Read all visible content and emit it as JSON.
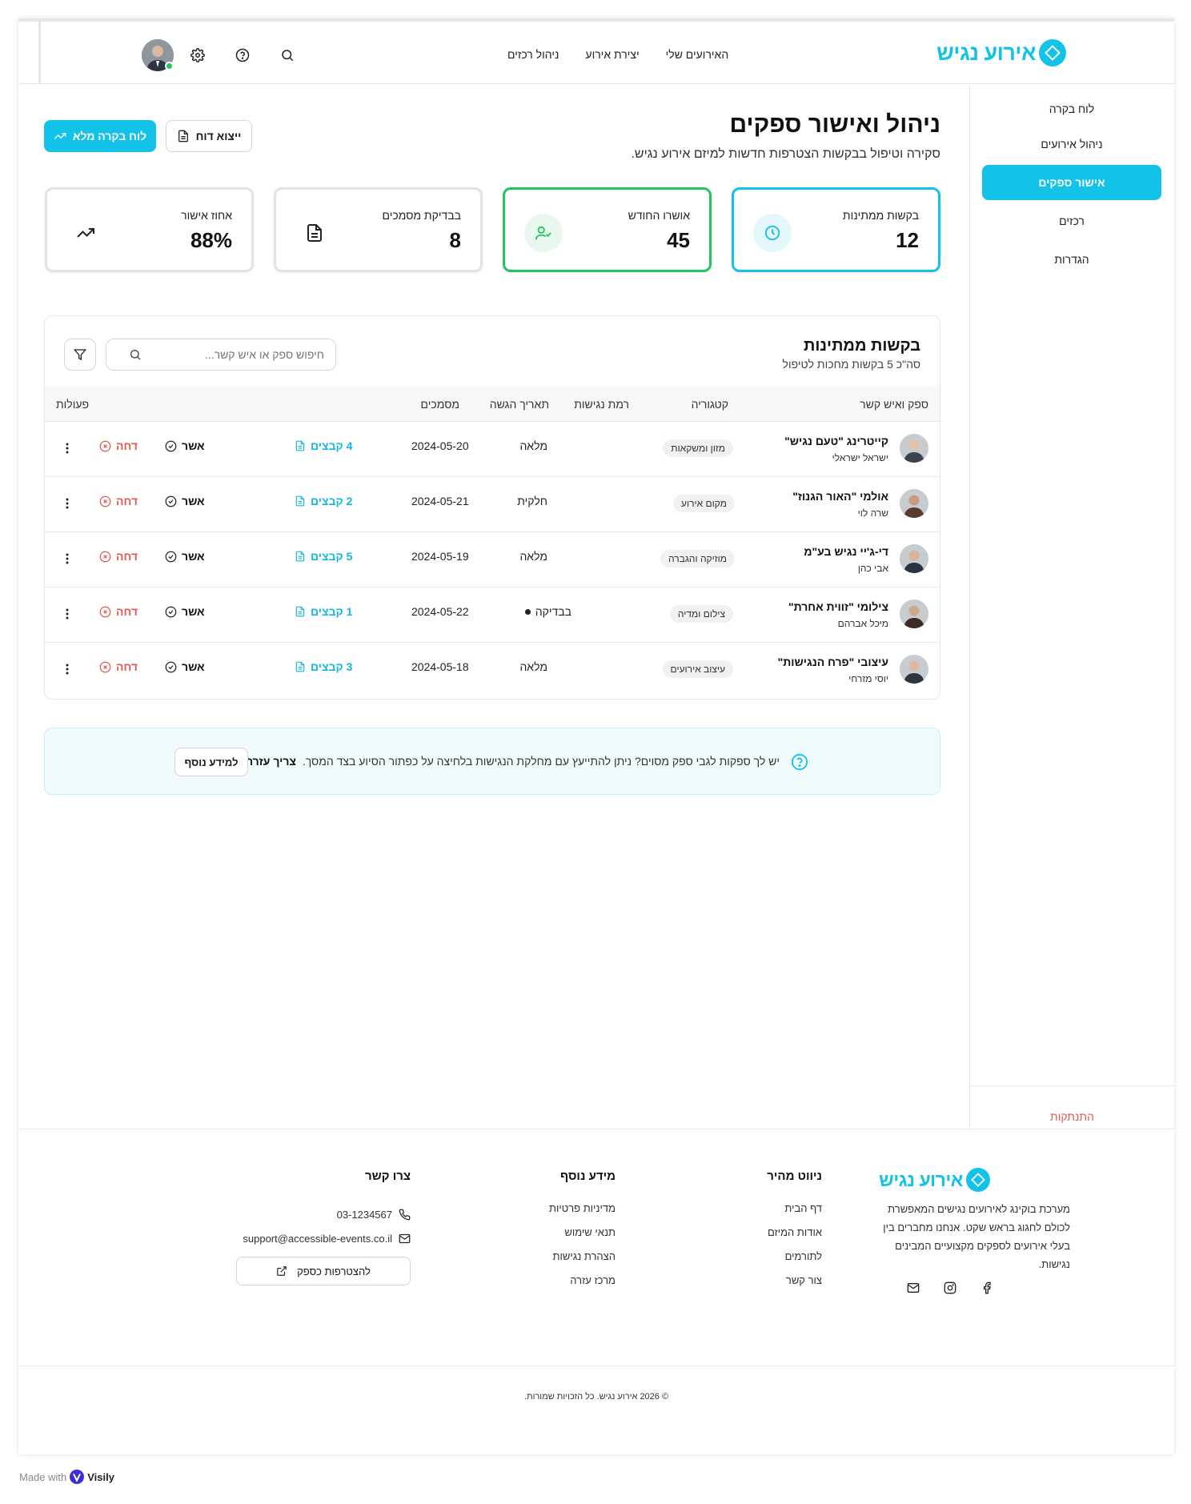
{
  "app": {
    "name": "אירוע נגיש",
    "brand_color": "#13c2e8"
  },
  "header": {
    "nav": [
      "האירועים שלי",
      "יצירת אירוע",
      "ניהול רכזים"
    ],
    "icons": [
      "search-icon",
      "help-icon",
      "gear-icon",
      "avatar"
    ]
  },
  "sidebar": {
    "items": [
      {
        "label": "לוח בקרה",
        "active": false
      },
      {
        "label": "ניהול אירועים",
        "active": false
      },
      {
        "label": "אישור ספקים",
        "active": true
      },
      {
        "label": "רכזים",
        "active": false
      },
      {
        "label": "הגדרות",
        "active": false
      }
    ],
    "logout": "התנתקות"
  },
  "page": {
    "title": "ניהול ואישור ספקים",
    "subtitle": "סקירה וטיפול בבקשות הצטרפות חדשות למיזם אירוע נגיש.",
    "btn_dashboard": "לוח בקרה מלא",
    "btn_export": "ייצוא דוח"
  },
  "stats": [
    {
      "label": "בקשות ממתינות",
      "value": "12",
      "icon": "clock-icon",
      "accent": "#13c2e8"
    },
    {
      "label": "אושרו החודש",
      "value": "45",
      "icon": "user-check-icon",
      "accent": "#22c55e"
    },
    {
      "label": "בבדיקת מסמכים",
      "value": "8",
      "icon": "document-icon"
    },
    {
      "label": "אחוז אישור",
      "value": "88%",
      "icon": "trending-up-icon"
    }
  ],
  "table": {
    "title": "בקשות ממתינות",
    "subtitle": "סה\"כ 5 בקשות מחכות לטיפול",
    "search_placeholder": "חיפוש ספק או איש קשר...",
    "columns": [
      "ספק ואיש קשר",
      "קטגוריה",
      "רמת נגישות",
      "תאריך הגשה",
      "מסמכים",
      "פעולות"
    ],
    "approve_label": "אשר",
    "reject_label": "דחה",
    "rows": [
      {
        "name": "קייטרינג \"טעם נגיש\"",
        "contact": "ישראל ישראלי",
        "category": "מזון ומשקאות",
        "level": "מלאה",
        "level_pending": false,
        "date": "2024-05-20",
        "docs": "4 קבצים"
      },
      {
        "name": "אולמי \"האור הגנוז\"",
        "contact": "שרה לוי",
        "category": "מקום אירוע",
        "level": "חלקית",
        "level_pending": false,
        "date": "2024-05-21",
        "docs": "2 קבצים"
      },
      {
        "name": "די-ג'יי נגיש בע\"מ",
        "contact": "אבי כהן",
        "category": "מוזיקה והגברה",
        "level": "מלאה",
        "level_pending": false,
        "date": "2024-05-19",
        "docs": "5 קבצים"
      },
      {
        "name": "צילומי \"זווית אחרת\"",
        "contact": "מיכל אברהם",
        "category": "צילום ומדיה",
        "level": "בבדיקה",
        "level_pending": true,
        "date": "2024-05-22",
        "docs": "1 קבצים"
      },
      {
        "name": "עיצובי \"פרח הנגישות\"",
        "contact": "יוסי מזרחי",
        "category": "עיצוב אירועים",
        "level": "מלאה",
        "level_pending": false,
        "date": "2024-05-18",
        "docs": "3 קבצים"
      }
    ]
  },
  "help": {
    "text": "יש לך ספקות לגבי ספק מסוים? ניתן להתייעץ עם מחלקת הנגישות בלחיצה על כפתור הסיוע בצד המסך.",
    "emphasis": "צריך עזרה?",
    "button": "למידע נוסף"
  },
  "footer": {
    "about": "מערכת בוקינג לאירועים נגישים המאפשרת לכולם לחגוג בראש שקט. אנחנו מחברים בין בעלי אירועים לספקים מקצועיים המבינים נגישות.",
    "social": [
      "facebook-icon",
      "instagram-icon",
      "mail-icon"
    ],
    "nav_title": "ניווט מהיר",
    "nav_links": [
      "דף הבית",
      "אודות המיזם",
      "לתורמים",
      "צור קשר"
    ],
    "info_title": "מידע נוסף",
    "info_links": [
      "מדיניות פרטיות",
      "תנאי שימוש",
      "הצהרת נגישות",
      "מרכז עזרה"
    ],
    "contact_title": "צרו קשר",
    "phone": "03-1234567",
    "email": "support@accessible-events.co.il",
    "join_button": "להצטרפות כספק",
    "copyright": "© 2026 אירוע נגיש. כל הזכויות שמורות."
  },
  "badge": {
    "prefix": "Made with",
    "brand": "Visily"
  }
}
